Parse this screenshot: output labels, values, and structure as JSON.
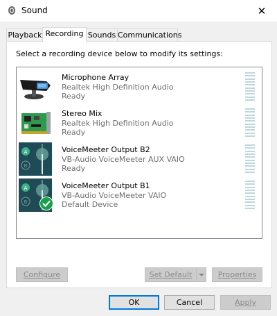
{
  "window": {
    "title": "Sound"
  },
  "tabs": [
    {
      "label": "Playback",
      "active": false
    },
    {
      "label": "Recording",
      "active": true
    },
    {
      "label": "Sounds",
      "active": false
    },
    {
      "label": "Communications",
      "active": false
    }
  ],
  "instruction": "Select a recording device below to modify its settings:",
  "devices": [
    {
      "name": "Microphone Array",
      "description": "Realtek High Definition Audio",
      "status": "Ready",
      "icon": "microphone-array-icon"
    },
    {
      "name": "Stereo Mix",
      "description": "Realtek High Definition Audio",
      "status": "Ready",
      "icon": "sound-card-icon"
    },
    {
      "name": "VoiceMeeter Output B2",
      "description": "VB-Audio VoiceMeeter AUX VAIO",
      "status": "Ready",
      "icon": "voicemeeter-icon"
    },
    {
      "name": "VoiceMeeter Output B1",
      "description": "VB-Audio VoiceMeeter VAIO",
      "status": "Default Device",
      "icon": "voicemeeter-icon",
      "default": true
    }
  ],
  "buttons": {
    "configure": "Configure",
    "set_default": "Set Default",
    "properties": "Properties",
    "ok": "OK",
    "cancel": "Cancel",
    "apply": "Apply"
  },
  "colors": {
    "accent": "#0078d7",
    "check": "#16a14a",
    "voicemeeter_bg": "#1e4b55"
  }
}
